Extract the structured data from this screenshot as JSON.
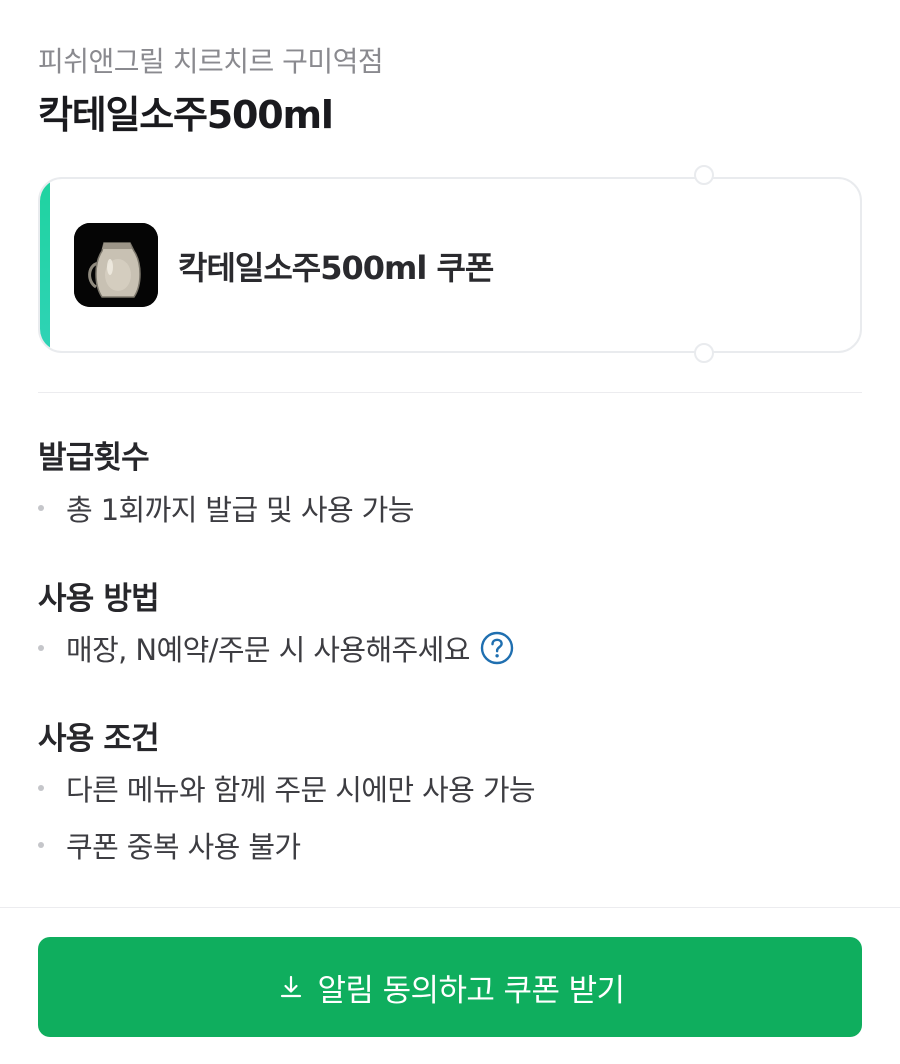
{
  "header": {
    "store_name": "피쉬앤그릴 치르치르 구미역점",
    "product_title": "칵테일소주500ml"
  },
  "coupon": {
    "label": "칵테일소주500ml 쿠폰",
    "thumbnail": "cocktail-soju-pitcher-image",
    "accent_color": "#1fd3a0"
  },
  "sections": {
    "issue": {
      "title": "발급횟수",
      "items": [
        "총 1회까지 발급 및 사용 가능"
      ]
    },
    "usage": {
      "title": "사용 방법",
      "items": [
        "매장, N예약/주문 시 사용해주세요"
      ],
      "help_icon": "question-circle-icon"
    },
    "conditions": {
      "title": "사용 조건",
      "items": [
        "다른 메뉴와 함께 주문 시에만 사용 가능",
        "쿠폰 중복 사용 불가"
      ]
    }
  },
  "cta": {
    "label": "알림 동의하고 쿠폰 받기",
    "icon": "download-icon",
    "color": "#0fae5e"
  }
}
